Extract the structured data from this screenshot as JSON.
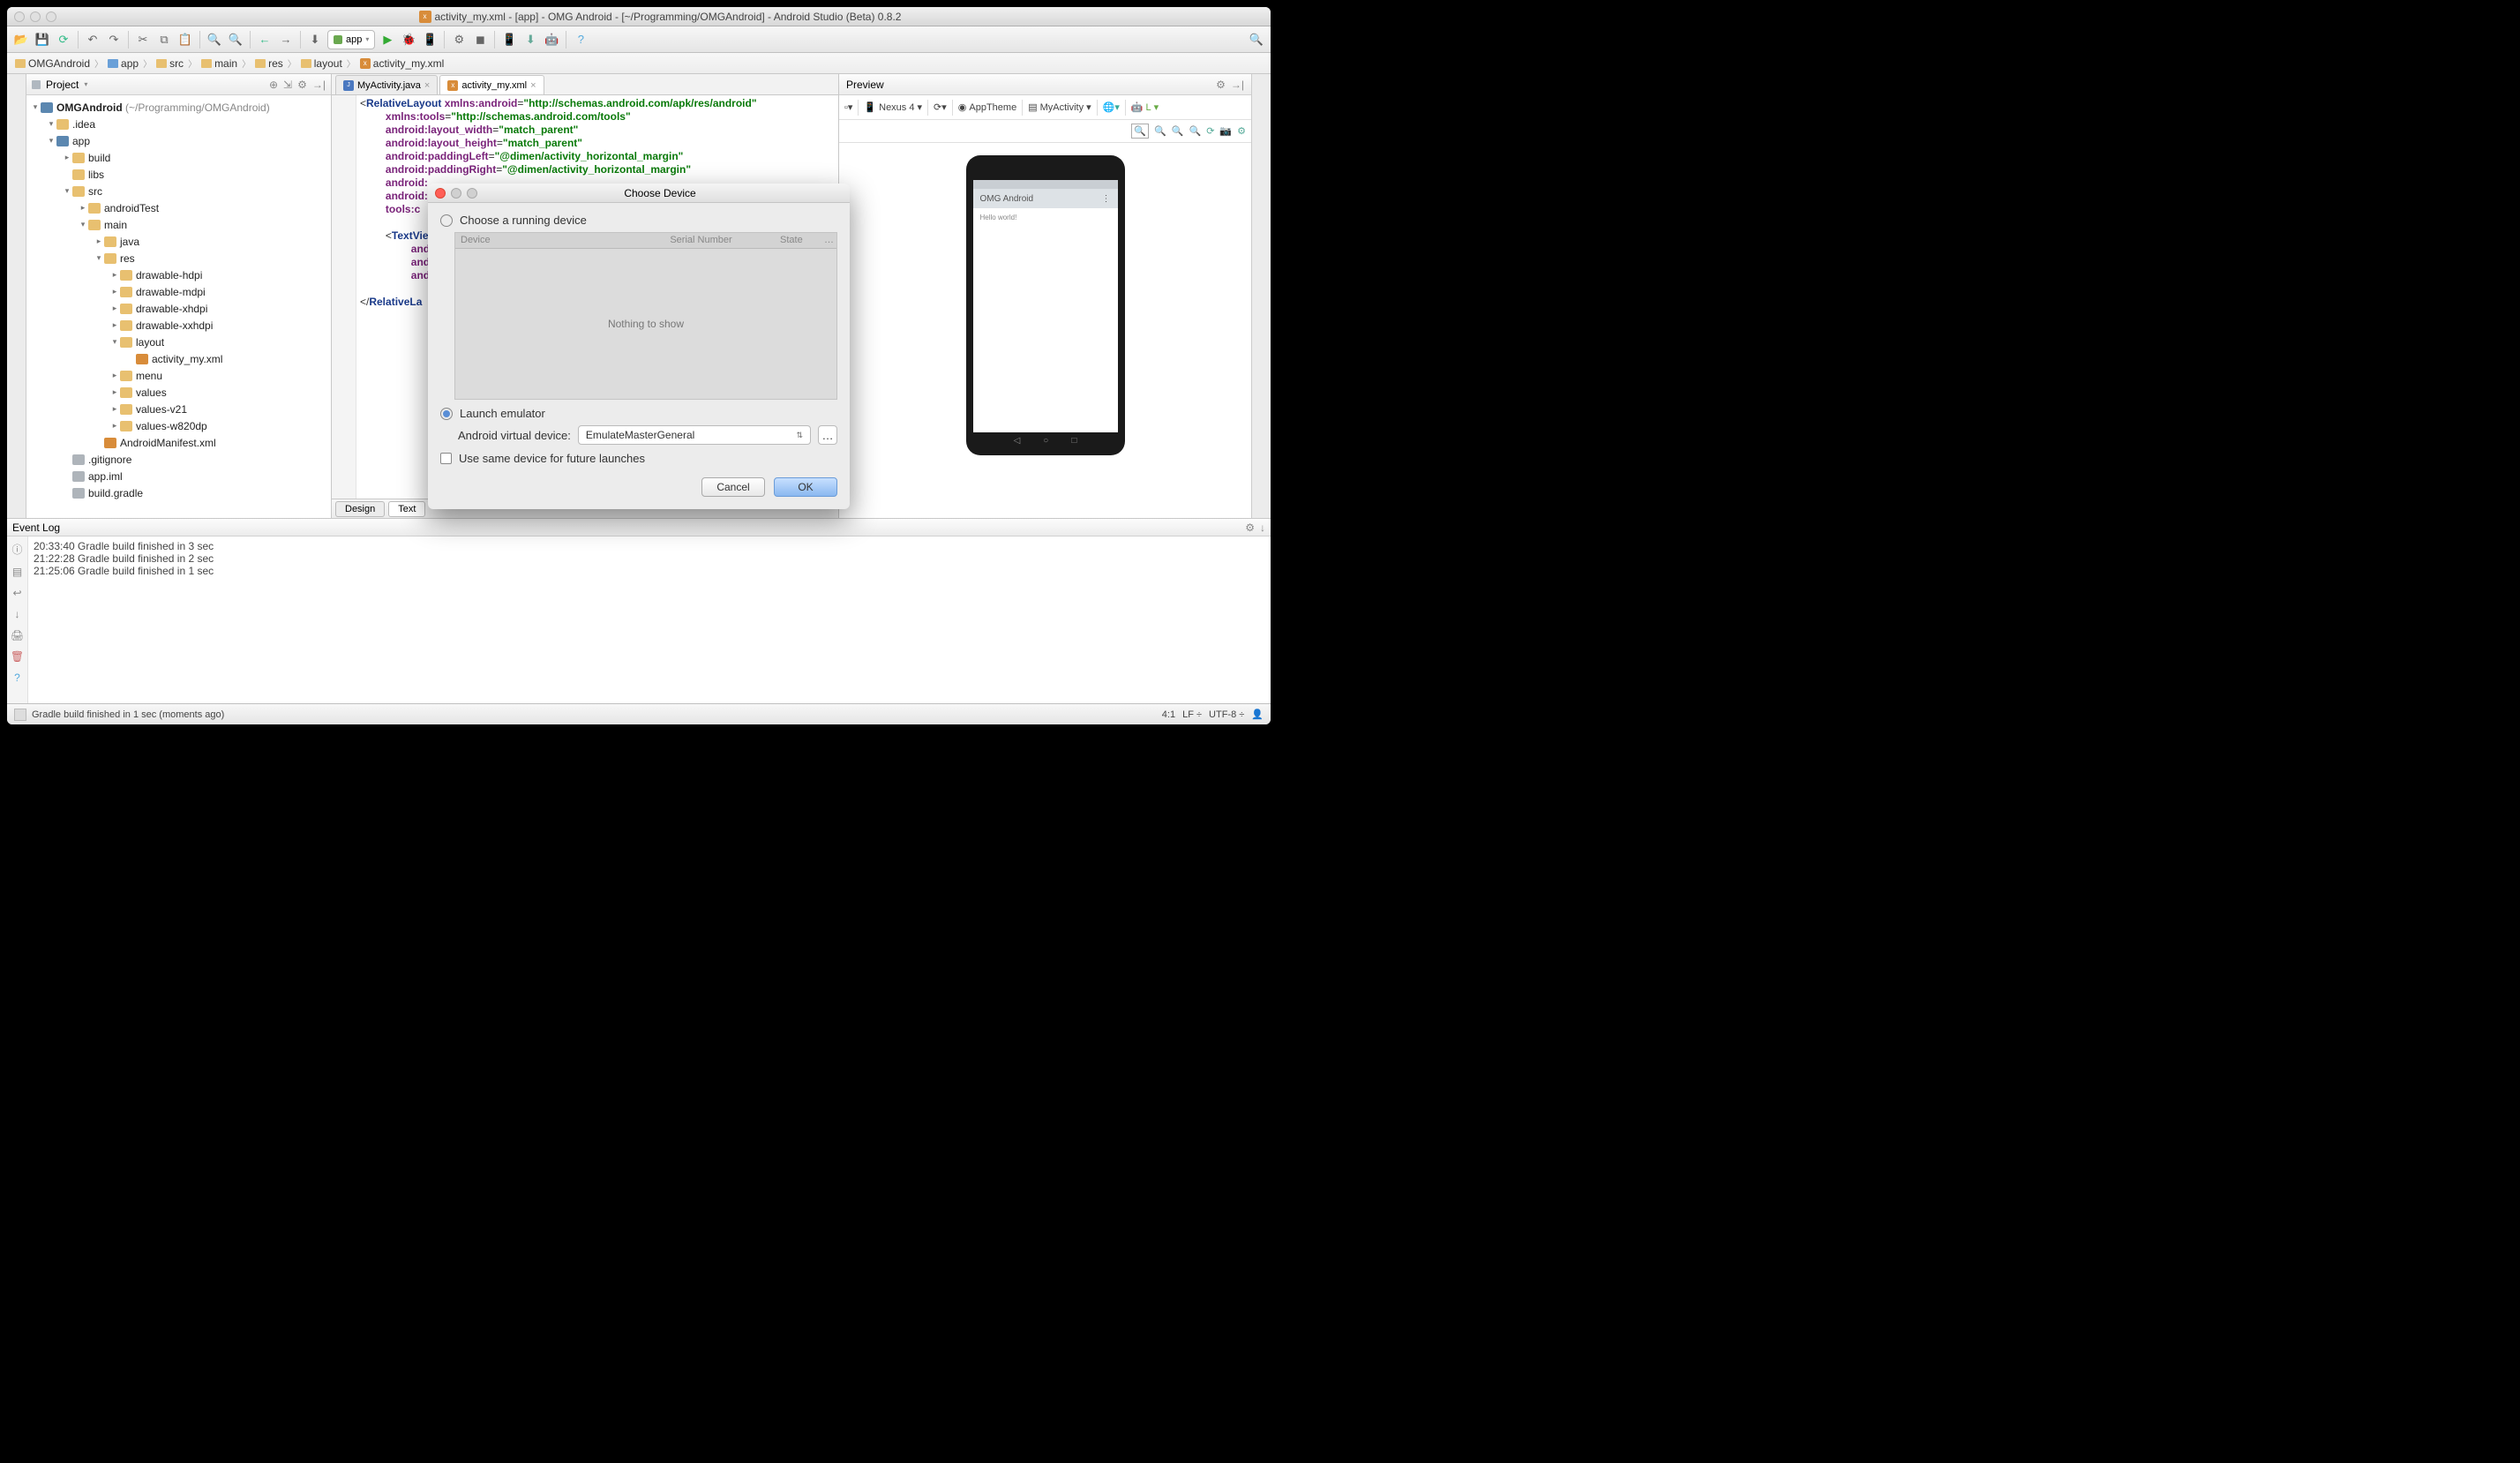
{
  "titlebar": {
    "title": "activity_my.xml - [app] - OMG Android - [~/Programming/OMGAndroid] - Android Studio (Beta) 0.8.2"
  },
  "toolbar": {
    "run_config": "app"
  },
  "breadcrumb": {
    "items": [
      "OMGAndroid",
      "app",
      "src",
      "main",
      "res",
      "layout",
      "activity_my.xml"
    ]
  },
  "project": {
    "title": "Project",
    "root_label": "OMGAndroid",
    "root_path": "(~/Programming/OMGAndroid)",
    "nodes": [
      {
        "depth": 1,
        "arrow": "▾",
        "icon": "ic-folder",
        "label": ".idea"
      },
      {
        "depth": 1,
        "arrow": "▾",
        "icon": "ic-module",
        "label": "app"
      },
      {
        "depth": 2,
        "arrow": "▸",
        "icon": "ic-folder",
        "label": "build"
      },
      {
        "depth": 2,
        "arrow": "",
        "icon": "ic-folder",
        "label": "libs"
      },
      {
        "depth": 2,
        "arrow": "▾",
        "icon": "ic-folder",
        "label": "src"
      },
      {
        "depth": 3,
        "arrow": "▸",
        "icon": "ic-folder",
        "label": "androidTest"
      },
      {
        "depth": 3,
        "arrow": "▾",
        "icon": "ic-folder",
        "label": "main"
      },
      {
        "depth": 4,
        "arrow": "▸",
        "icon": "ic-folder",
        "label": "java"
      },
      {
        "depth": 4,
        "arrow": "▾",
        "icon": "ic-folder",
        "label": "res"
      },
      {
        "depth": 5,
        "arrow": "▸",
        "icon": "ic-folder",
        "label": "drawable-hdpi"
      },
      {
        "depth": 5,
        "arrow": "▸",
        "icon": "ic-folder",
        "label": "drawable-mdpi"
      },
      {
        "depth": 5,
        "arrow": "▸",
        "icon": "ic-folder",
        "label": "drawable-xhdpi"
      },
      {
        "depth": 5,
        "arrow": "▸",
        "icon": "ic-folder",
        "label": "drawable-xxhdpi"
      },
      {
        "depth": 5,
        "arrow": "▾",
        "icon": "ic-folder",
        "label": "layout"
      },
      {
        "depth": 6,
        "arrow": "",
        "icon": "ic-file",
        "label": "activity_my.xml"
      },
      {
        "depth": 5,
        "arrow": "▸",
        "icon": "ic-folder",
        "label": "menu"
      },
      {
        "depth": 5,
        "arrow": "▸",
        "icon": "ic-folder",
        "label": "values"
      },
      {
        "depth": 5,
        "arrow": "▸",
        "icon": "ic-folder",
        "label": "values-v21"
      },
      {
        "depth": 5,
        "arrow": "▸",
        "icon": "ic-folder",
        "label": "values-w820dp"
      },
      {
        "depth": 4,
        "arrow": "",
        "icon": "ic-file",
        "label": "AndroidManifest.xml"
      },
      {
        "depth": 2,
        "arrow": "",
        "icon": "ic-other",
        "label": ".gitignore"
      },
      {
        "depth": 2,
        "arrow": "",
        "icon": "ic-other",
        "label": "app.iml"
      },
      {
        "depth": 2,
        "arrow": "",
        "icon": "ic-other",
        "label": "build.gradle"
      }
    ]
  },
  "editor": {
    "tabs": [
      {
        "label": "MyActivity.java",
        "active": false,
        "icon": "java"
      },
      {
        "label": "activity_my.xml",
        "active": true,
        "icon": "xml"
      }
    ],
    "code": {
      "l1a": "<",
      "l1b": "RelativeLayout",
      "l1c": " xmlns:android",
      "l1d": "=",
      "l1e": "\"http://schemas.android.com/apk/res/android\"",
      "l2a": "xmlns:tools",
      "l2b": "=",
      "l2c": "\"http://schemas.android.com/tools\"",
      "l3a": "android:layout_width",
      "l3b": "=",
      "l3c": "\"match_parent\"",
      "l4a": "android:layout_height",
      "l4b": "=",
      "l4c": "\"match_parent\"",
      "l5a": "android:paddingLeft",
      "l5b": "=",
      "l5c": "\"@dimen/activity_horizontal_margin\"",
      "l6a": "android:paddingRight",
      "l6b": "=",
      "l6c": "\"@dimen/activity_horizontal_margin\"",
      "l7": "android:",
      "l8": "android:",
      "l9": "tools:c",
      "l10a": "<",
      "l10b": "TextVie",
      "l11": "andr",
      "l12": "andr",
      "l13": "andr",
      "l14a": "</",
      "l14b": "RelativeLa"
    },
    "bottom_tabs": {
      "design": "Design",
      "text": "Text"
    }
  },
  "preview": {
    "title": "Preview",
    "device": "Nexus 4",
    "theme": "AppTheme",
    "activity": "MyActivity",
    "api": "L",
    "app_title": "OMG Android",
    "hello": "Hello world!"
  },
  "event_log": {
    "title": "Event Log",
    "lines": [
      "20:33:40 Gradle build finished in 3 sec",
      "21:22:28 Gradle build finished in 2 sec",
      "21:25:06 Gradle build finished in 1 sec"
    ]
  },
  "dialog": {
    "title": "Choose Device",
    "opt_running": "Choose a running device",
    "cols": {
      "device": "Device",
      "serial": "Serial Number",
      "state": "State"
    },
    "empty": "Nothing to show",
    "opt_launch": "Launch emulator",
    "avd_label": "Android virtual device:",
    "avd_value": "EmulateMasterGeneral",
    "remember": "Use same device for future launches",
    "cancel": "Cancel",
    "ok": "OK"
  },
  "statusbar": {
    "msg": "Gradle build finished in 1 sec (moments ago)",
    "pos": "4:1",
    "line_end": "LF",
    "encoding": "UTF-8"
  }
}
